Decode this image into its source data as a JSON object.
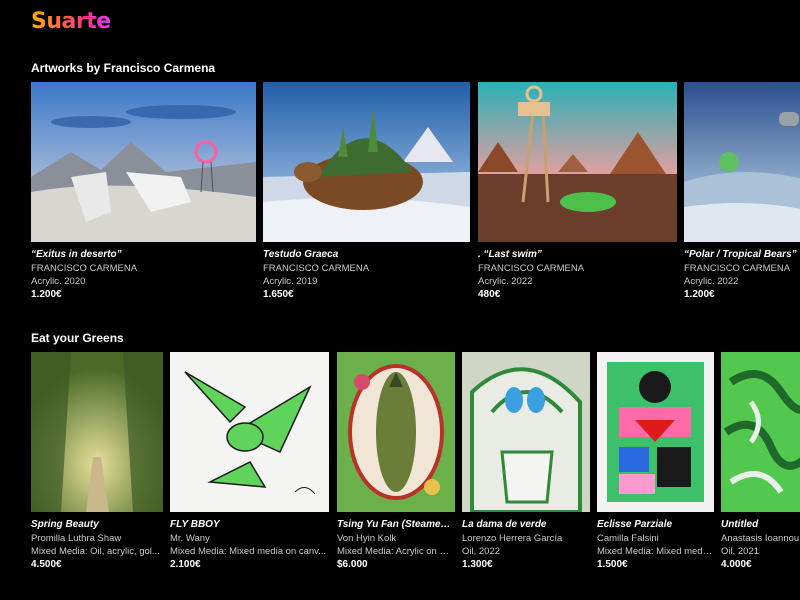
{
  "brand": {
    "logo_text": "Suarte"
  },
  "sections": [
    {
      "title": "Artworks by Francisco Carmena",
      "cards": [
        {
          "title": "“Exitus in deserto”",
          "artist": "FRANCISCO CARMENA",
          "medium": "Acrylic. 2020",
          "price": "1.200€"
        },
        {
          "title": "Testudo Graeca",
          "artist": "FRANCISCO CARMENA",
          "medium": "Acrylic. 2019",
          "price": "1.650€"
        },
        {
          "title": ". “Last swim”",
          "artist": "FRANCISCO CARMENA",
          "medium": "Acrylic. 2022",
          "price": "480€"
        },
        {
          "title": "“Polar / Tropical Bears”",
          "artist": "FRANCISCO CARMENA",
          "medium": "Acrylic. 2022",
          "price": "1.200€"
        }
      ]
    },
    {
      "title": "Eat your Greens",
      "cards": [
        {
          "title": "Spring Beauty",
          "artist": "Promilla Luthra Shaw",
          "medium": "Mixed Media: Oil, acrylic, gol...",
          "price": "4.500€"
        },
        {
          "title": "FLY BBOY",
          "artist": "Mr. Wany",
          "medium": "Mixed Media: Mixed media on canv...",
          "price": "2.100€"
        },
        {
          "title": "Tsing Yu Fan (Steamed Fi...",
          "artist": "Von Hyin Kolk",
          "medium": "Mixed Media: Acrylic on Vi...",
          "price": "$6.000"
        },
        {
          "title": "La dama de verde",
          "artist": "Lorenzo Herrera García",
          "medium": "Oil, 2022",
          "price": "1.300€"
        },
        {
          "title": "Eclisse Parziale",
          "artist": "Camilla Falsini",
          "medium": "Mixed Media: Mixed media...",
          "price": "1.500€"
        },
        {
          "title": "Untitled",
          "artist": "Anastasis Ioannou",
          "medium": "Oil, 2021",
          "price": "4.000€"
        }
      ]
    }
  ]
}
